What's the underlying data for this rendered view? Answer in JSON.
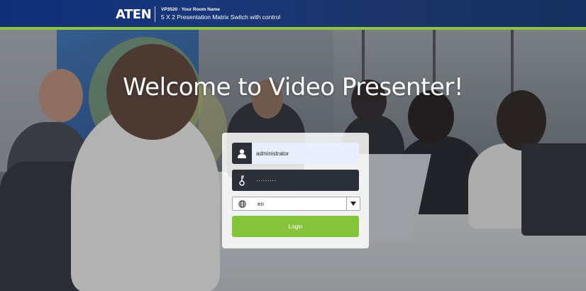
{
  "header": {
    "logo": "ATEN",
    "model_line": "VP3520 · Your Room Name",
    "subtitle": "5 X 2 Presentation Matrix Switch with control"
  },
  "welcome_text": "Welcome to Video Presenter!",
  "login": {
    "username_value": "administrator",
    "password_value": "·········",
    "language_value": "en",
    "login_label": "Login",
    "icons": {
      "user": "user-icon",
      "password": "key-icon",
      "language": "globe-icon",
      "dropdown": "triangle-down-icon"
    }
  },
  "colors": {
    "header_bg": "#19377a",
    "accent_green": "#85c33a",
    "field_dark": "#2c3139",
    "username_bg": "#e9efff"
  }
}
